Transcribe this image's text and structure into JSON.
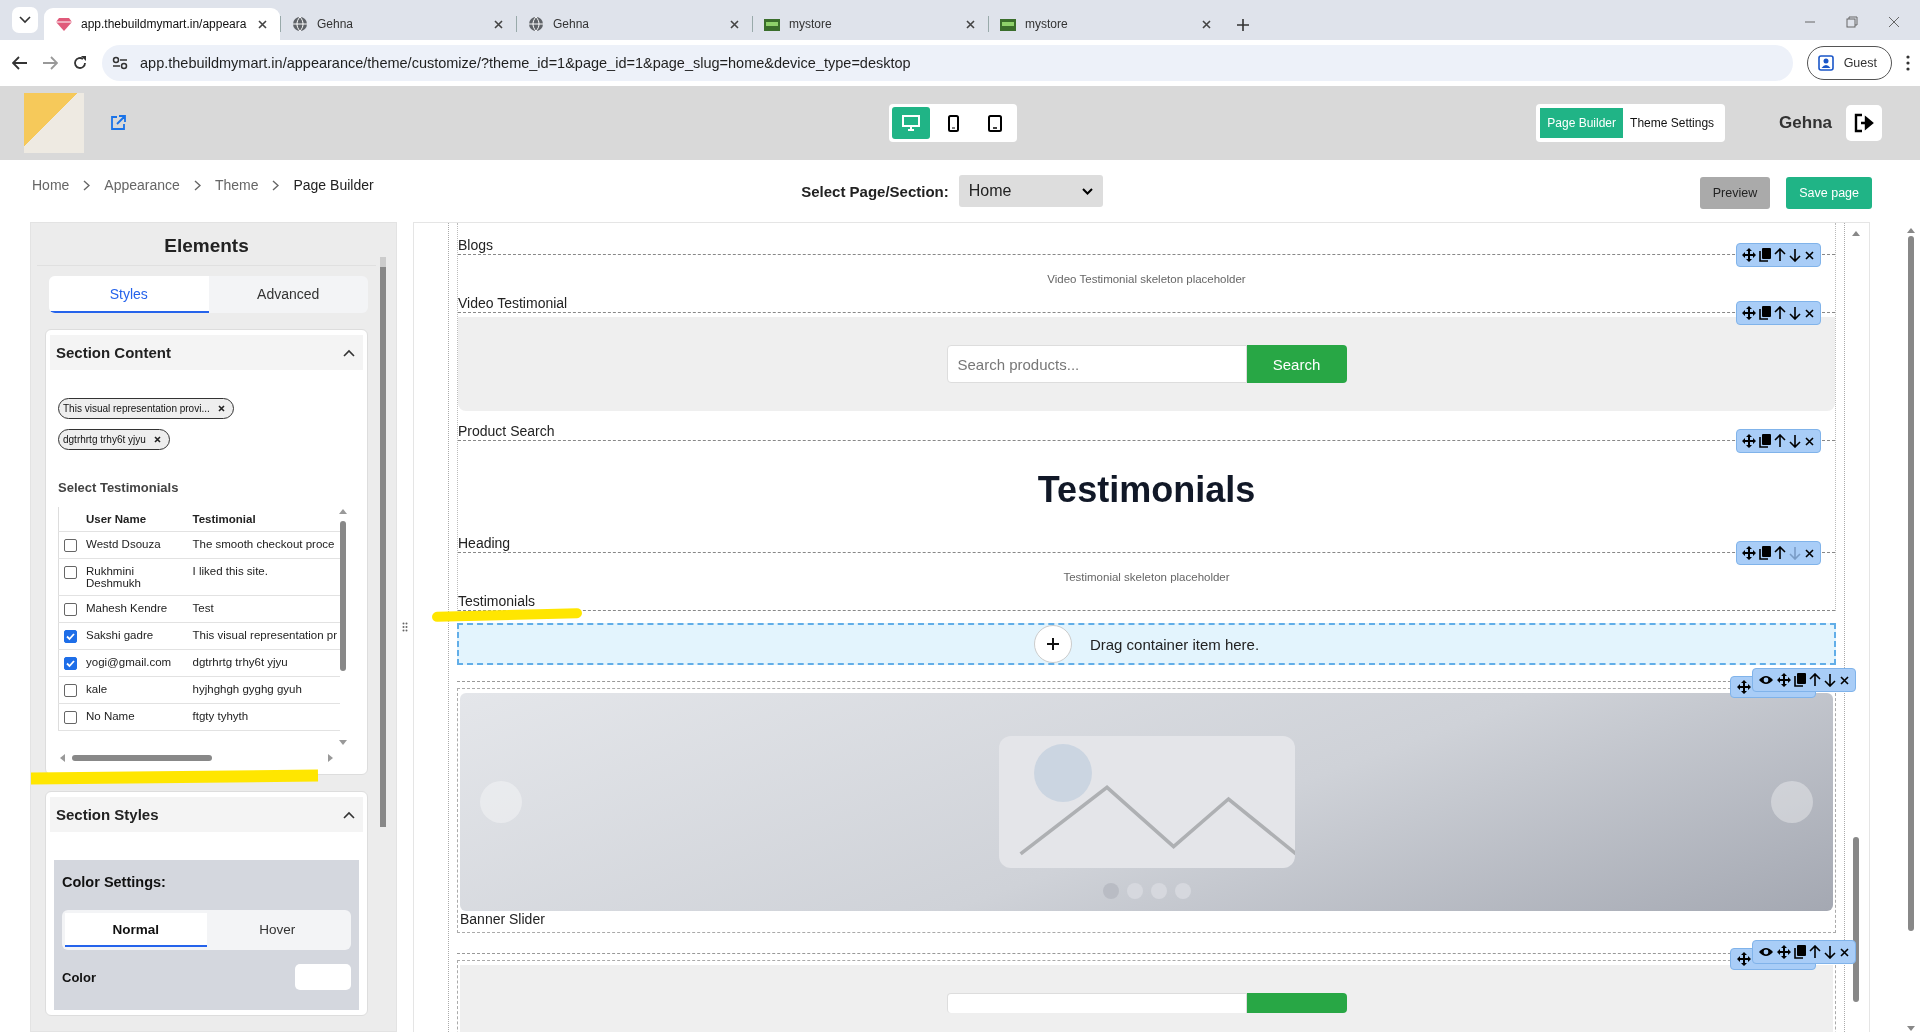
{
  "browser": {
    "tabs": [
      {
        "title": "app.thebuildmymart.in/appeara",
        "kind": "gem",
        "selected": true
      },
      {
        "title": "Gehna",
        "kind": "globe",
        "selected": false
      },
      {
        "title": "Gehna",
        "kind": "globe",
        "selected": false
      },
      {
        "title": "mystore",
        "kind": "store",
        "selected": false
      },
      {
        "title": "mystore",
        "kind": "store",
        "selected": false
      }
    ],
    "url": "app.thebuildmymart.in/appearance/theme/customize/?theme_id=1&page_id=1&page_slug=home&device_type=desktop",
    "profile": "Guest"
  },
  "header": {
    "devices": [
      {
        "kind": "desktop",
        "selected": true
      },
      {
        "kind": "phone",
        "selected": false
      },
      {
        "kind": "tablet",
        "selected": false
      }
    ],
    "modes": [
      {
        "label": "Page Builder",
        "selected": true
      },
      {
        "label": "Theme Settings",
        "selected": false
      }
    ],
    "user": "Gehna"
  },
  "toolbar": {
    "breadcrumb": [
      "Home",
      "Appearance",
      "Theme",
      "Page Builder"
    ],
    "page_select_label": "Select Page/Section:",
    "page_select_value": "Home",
    "preview": "Preview",
    "save": "Save page"
  },
  "sidebar": {
    "title": "Elements",
    "tabs": [
      {
        "label": "Styles",
        "selected": true
      },
      {
        "label": "Advanced",
        "selected": false
      }
    ],
    "section_content": {
      "title": "Section Content",
      "expanded": true,
      "chips": [
        "This visual representation provi...",
        "dgtrhrtg trhy6t yjyu"
      ],
      "table_title": "Select Testimonials",
      "columns": [
        "User Name",
        "Testimonial"
      ],
      "rows": [
        {
          "user": "Westd Dsouza",
          "testimonial": "The smooth checkout proce",
          "checked": false
        },
        {
          "user": "Rukhmini Deshmukh",
          "testimonial": "I liked this site.",
          "checked": false
        },
        {
          "user": "Mahesh Kendre",
          "testimonial": "Test",
          "checked": false
        },
        {
          "user": "Sakshi gadre",
          "testimonial": "This visual representation pr",
          "checked": true
        },
        {
          "user": "yogi@gmail.com",
          "testimonial": "dgtrhrtg trhy6t yjyu",
          "checked": true
        },
        {
          "user": "kale",
          "testimonial": "hyjhghgh gyghg gyuh",
          "checked": false
        },
        {
          "user": "No Name",
          "testimonial": "ftgty tyhyth",
          "checked": false
        }
      ]
    },
    "section_styles": {
      "title": "Section Styles",
      "expanded": true,
      "color_settings_title": "Color Settings:",
      "state_tabs": [
        {
          "label": "Normal",
          "selected": true
        },
        {
          "label": "Hover",
          "selected": false
        }
      ],
      "color_label": "Color"
    }
  },
  "canvas": {
    "sections": [
      {
        "kind": "label_only",
        "label": "Blogs"
      },
      {
        "kind": "placeholder",
        "label": "Video Testimonial",
        "text": "Video Testimonial skeleton placeholder",
        "can_move_down": true
      },
      {
        "kind": "search",
        "label": "Product Search",
        "placeholder": "Search products...",
        "button": "Search",
        "can_move_down": true
      },
      {
        "kind": "heading",
        "label": "Heading",
        "text": "Testimonials",
        "can_move_down": true
      },
      {
        "kind": "placeholder",
        "label": "Testimonials",
        "text": "Testimonial skeleton placeholder",
        "can_move_down": false
      }
    ],
    "dropzone": "Drag container item here.",
    "containers": [
      {
        "kind": "banner",
        "label": "Banner Slider",
        "dots": [
          {
            "selected": true
          },
          {
            "selected": false
          },
          {
            "selected": false
          },
          {
            "selected": false
          }
        ]
      },
      {
        "kind": "search"
      }
    ]
  }
}
